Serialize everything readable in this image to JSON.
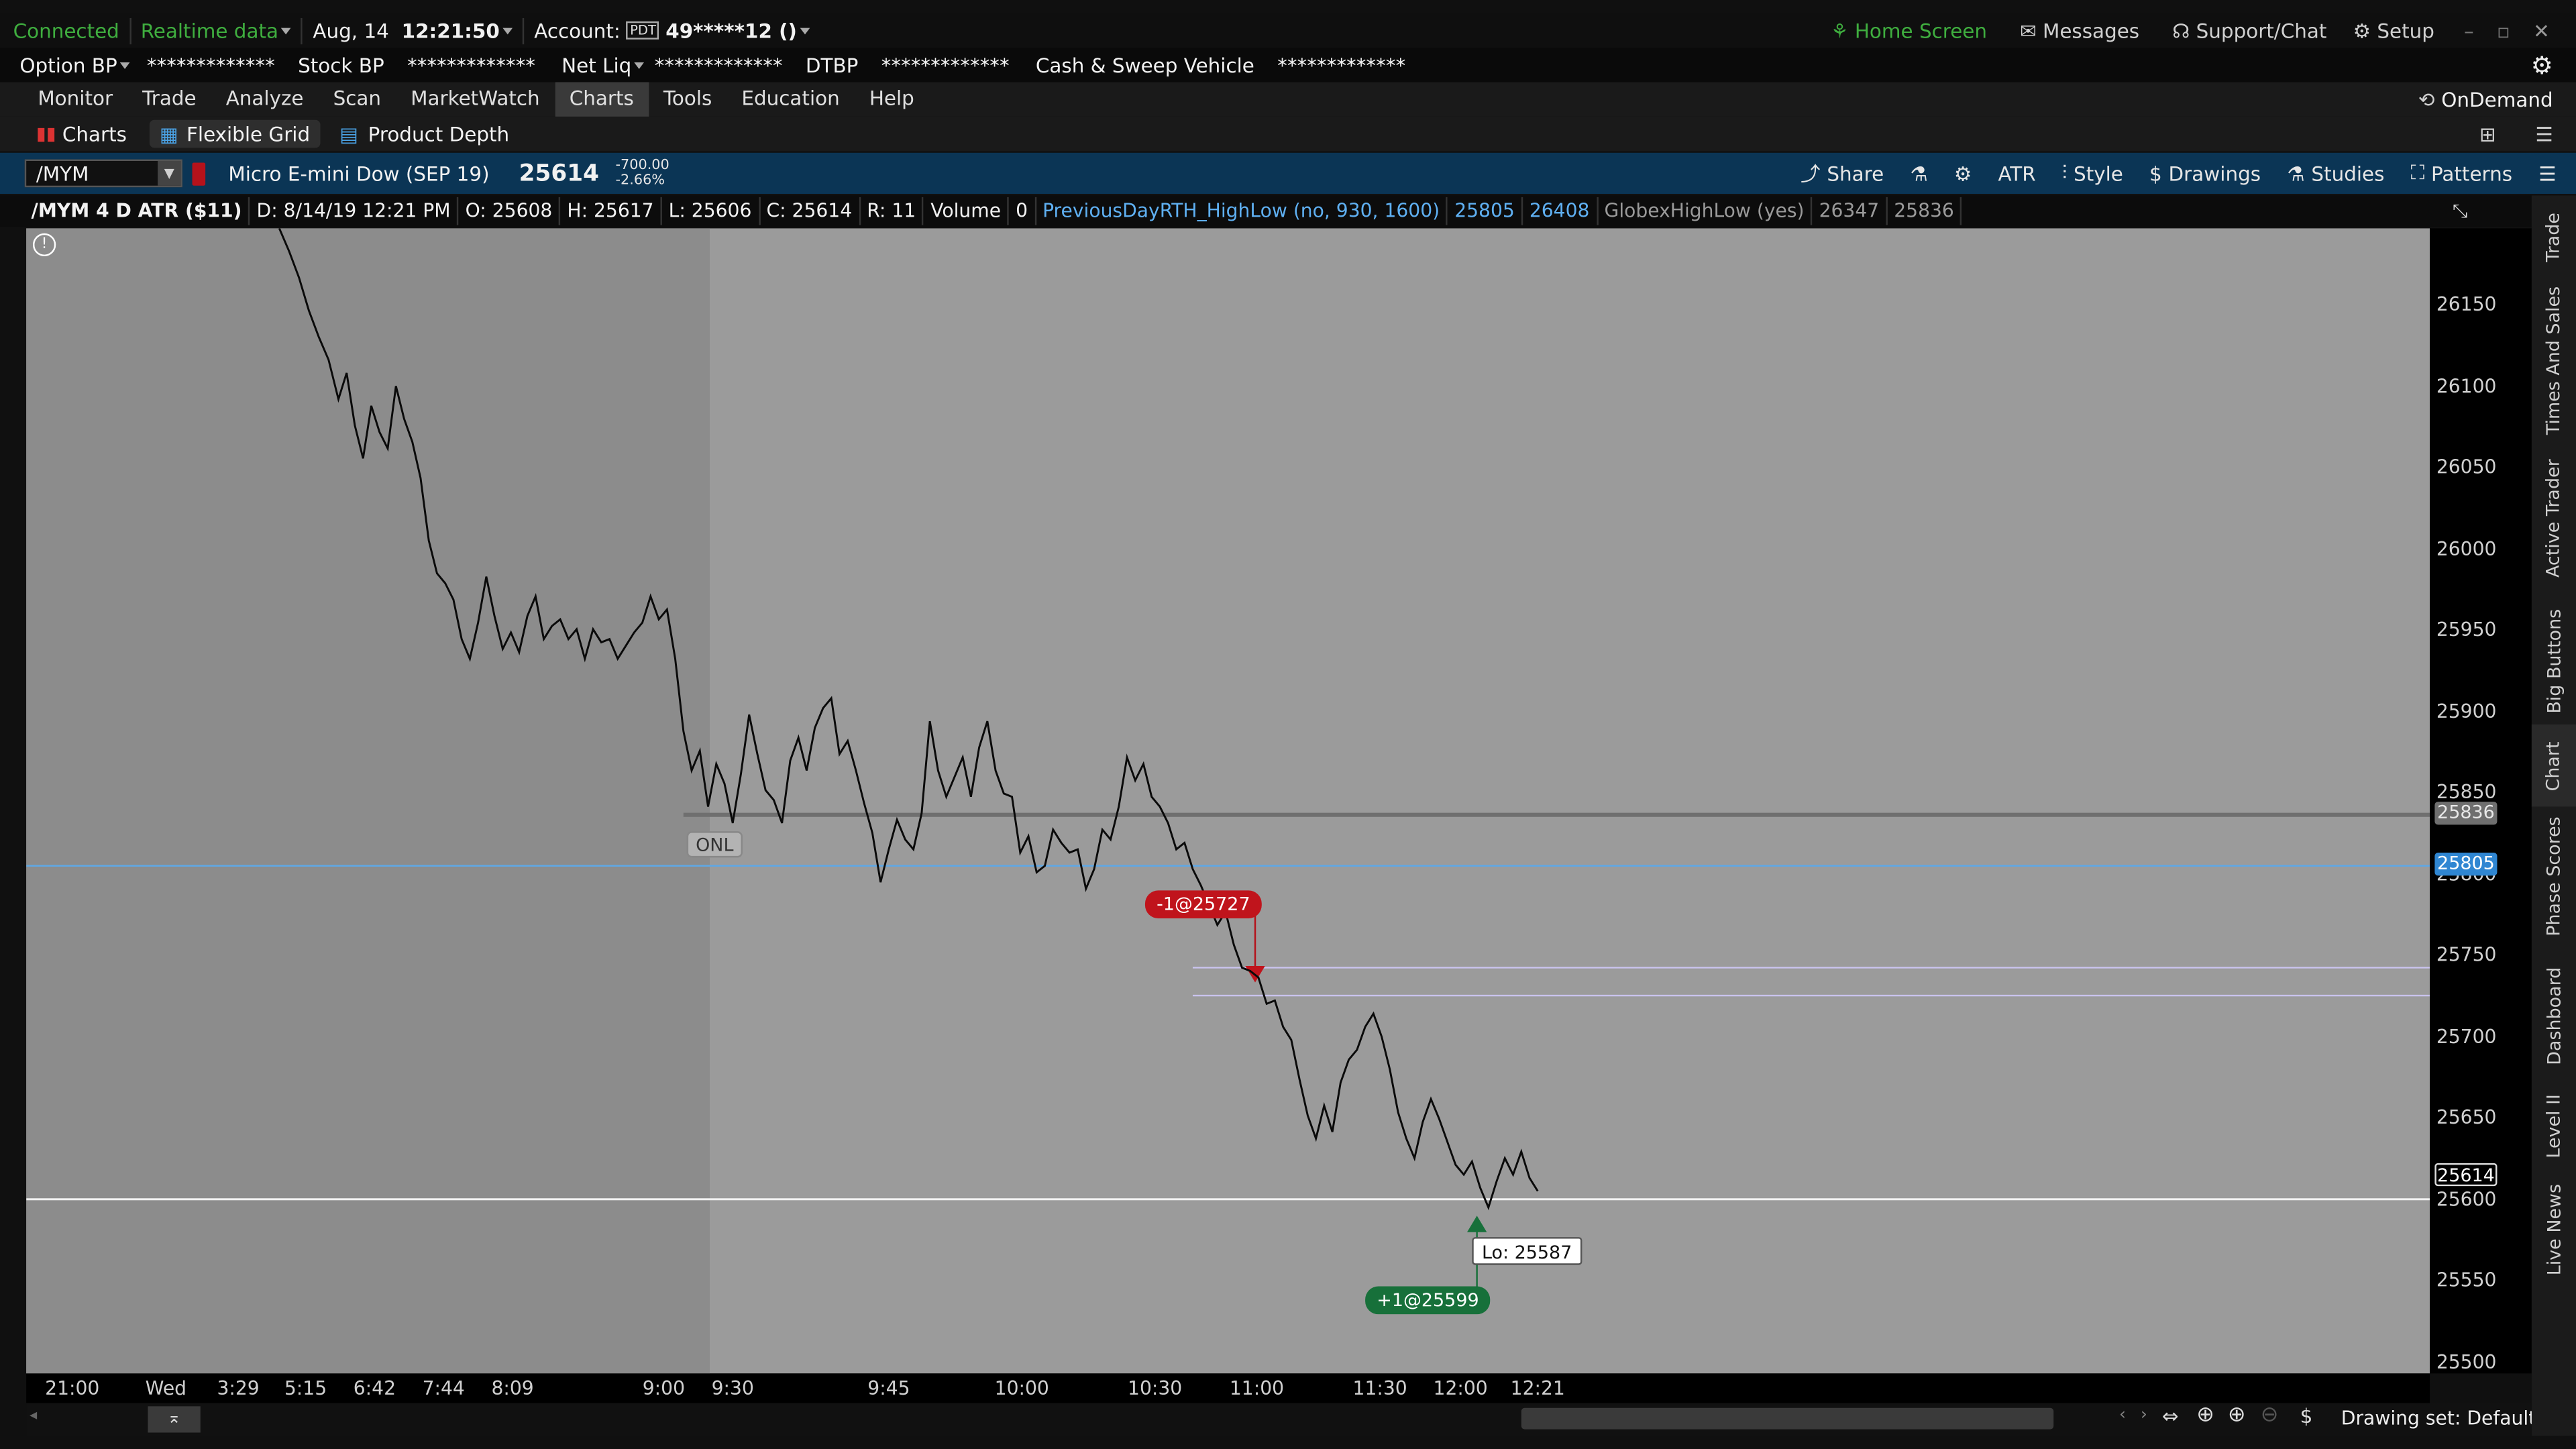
{
  "status": {
    "connection": "Connected",
    "feed": "Realtime data",
    "date": "Aug, 14",
    "time": "12:21:50",
    "account_label": "Account:",
    "account_badge": "PDT",
    "account_number": "49*****12 ()"
  },
  "top_right": {
    "home": "Home Screen",
    "messages": "Messages",
    "support": "Support/Chat",
    "setup": "Setup"
  },
  "balances": [
    {
      "label": "Option BP",
      "value": "*************"
    },
    {
      "label": "Stock BP",
      "value": "*************"
    },
    {
      "label": "Net Liq",
      "value": "*************"
    },
    {
      "label": "DTBP",
      "value": "*************"
    },
    {
      "label": "Cash & Sweep Vehicle",
      "value": "*************"
    }
  ],
  "menu": [
    "Monitor",
    "Trade",
    "Analyze",
    "Scan",
    "MarketWatch",
    "Charts",
    "Tools",
    "Education",
    "Help"
  ],
  "menu_active": "Charts",
  "ondemand": "OnDemand",
  "subtabs": [
    "Charts",
    "Flexible Grid",
    "Product Depth"
  ],
  "chart_header": {
    "symbol": "/MYM",
    "description": "Micro E-mini Dow (SEP 19)",
    "last": "25614",
    "change": "-700.00",
    "change_pct": "-2.66%"
  },
  "chart_tools": [
    "Share",
    "ATR",
    "Style",
    "Drawings",
    "Studies",
    "Patterns"
  ],
  "study_bar": [
    "/MYM 4 D ATR ($11)",
    "D: 8/14/19 12:21 PM",
    "O: 25608",
    "H: 25617",
    "L: 25606",
    "C: 25614",
    "R: 11",
    "Volume",
    "0",
    "PreviousDayRTH_HighLow (no, 930, 1600)",
    "25805",
    "26408",
    "GlobexHighLow (yes)",
    "26347",
    "25836"
  ],
  "price_axis": [
    "26150",
    "26100",
    "26050",
    "26000",
    "25950",
    "25900",
    "25850",
    "25800",
    "25750",
    "25700",
    "25650",
    "25600",
    "25550",
    "25500"
  ],
  "price_tags": {
    "globex_low": "25836",
    "prev_day_low": "25805",
    "last": "25614"
  },
  "time_axis": [
    "21:00",
    "Wed",
    "3:29",
    "5:15",
    "6:42",
    "7:44",
    "8:09",
    "9:00",
    "9:30",
    "9:45",
    "10:00",
    "10:30",
    "11:00",
    "11:30",
    "12:00",
    "12:21"
  ],
  "labels": {
    "onl": "ONL",
    "sell_fill": "-1@25727",
    "buy_fill": "+1@25599",
    "low": "Lo: 25587"
  },
  "side_tabs": [
    "Trade",
    "Times And Sales",
    "Active Trader",
    "Big Buttons",
    "Chart",
    "Phase Scores",
    "Dashboard",
    "Level II",
    "Live News"
  ],
  "drawing_set": "Drawing set: Default",
  "colors": {
    "connected": "#3fae3f",
    "toolbar_blue": "#0b3555",
    "sell": "#c0141c",
    "buy": "#17703a",
    "level_blue": "#4a9de0"
  }
}
